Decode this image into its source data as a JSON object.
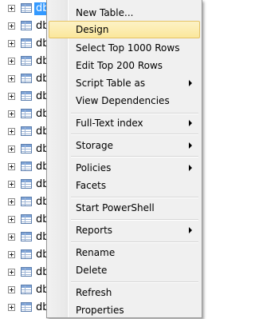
{
  "tree": {
    "rows": [
      {
        "label": "dbo.",
        "selected": true
      },
      {
        "label": "db"
      },
      {
        "label": "db"
      },
      {
        "label": "db"
      },
      {
        "label": "db"
      },
      {
        "label": "db"
      },
      {
        "label": "db"
      },
      {
        "label": "db"
      },
      {
        "label": "db"
      },
      {
        "label": "db"
      },
      {
        "label": "db"
      },
      {
        "label": "db"
      },
      {
        "label": "db"
      },
      {
        "label": "db"
      },
      {
        "label": "db"
      },
      {
        "label": "db"
      },
      {
        "label": "db"
      },
      {
        "label": "db"
      }
    ]
  },
  "context_menu": {
    "items": [
      {
        "label": "New Table...",
        "submenu": false
      },
      {
        "label": "Design",
        "submenu": false,
        "highlighted": true
      },
      {
        "label": "Select Top 1000 Rows",
        "submenu": false
      },
      {
        "label": "Edit Top 200 Rows",
        "submenu": false
      },
      {
        "label": "Script Table as",
        "submenu": true
      },
      {
        "label": "View Dependencies",
        "submenu": false
      },
      {
        "separator": true
      },
      {
        "label": "Full-Text index",
        "submenu": true
      },
      {
        "separator": true
      },
      {
        "label": "Storage",
        "submenu": true
      },
      {
        "separator": true
      },
      {
        "label": "Policies",
        "submenu": true
      },
      {
        "label": "Facets",
        "submenu": false
      },
      {
        "separator": true
      },
      {
        "label": "Start PowerShell",
        "submenu": false
      },
      {
        "separator": true
      },
      {
        "label": "Reports",
        "submenu": true
      },
      {
        "separator": true
      },
      {
        "label": "Rename",
        "submenu": false
      },
      {
        "label": "Delete",
        "submenu": false
      },
      {
        "separator": true
      },
      {
        "label": "Refresh",
        "submenu": false
      },
      {
        "label": "Properties",
        "submenu": false
      }
    ]
  },
  "colors": {
    "highlight_fill": "#fbe79b",
    "highlight_border": "#e5c365",
    "selection": "#3399ff"
  }
}
